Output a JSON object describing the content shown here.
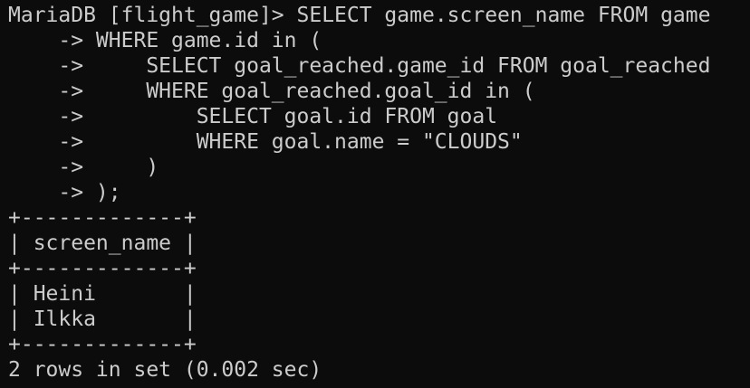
{
  "terminal": {
    "prompt": "MariaDB [flight_game]> ",
    "query_lines": [
      "SELECT game.screen_name FROM game",
      "    -> WHERE game.id in (",
      "    ->     SELECT goal_reached.game_id FROM goal_reached",
      "    ->     WHERE goal_reached.goal_id in (",
      "    ->         SELECT goal.id FROM goal",
      "    ->         WHERE goal.name = \"CLOUDS\"",
      "    ->     )",
      "    -> );"
    ],
    "result_table": {
      "border": "+-------------+",
      "header": "| screen_name |",
      "rows": [
        "| Heini       |",
        "| Ilkka       |"
      ]
    },
    "summary": "2 rows in set (0.002 sec)"
  },
  "colors": {
    "background": "#0c0c0c",
    "text": "#cccccc"
  }
}
